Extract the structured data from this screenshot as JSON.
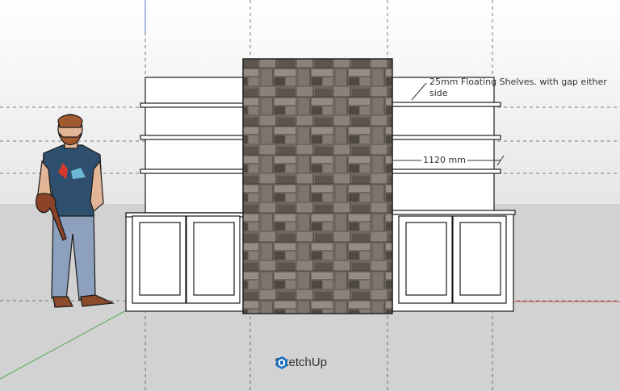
{
  "app": {
    "brand": "SketchUp"
  },
  "annotations": {
    "shelf_note_line1": "25mm Floating Shelves. with gap either",
    "shelf_note_line2": "side",
    "dimension": "1120 mm"
  },
  "icons": {
    "logo": "sketchup-logo-icon"
  },
  "colors": {
    "sky": "#e9e9e9",
    "ground": "#d3d3d3",
    "cabinet": "#ffffff",
    "outline": "#1a1a1a",
    "stone": "#6b645c",
    "brand": "#1e73be"
  }
}
